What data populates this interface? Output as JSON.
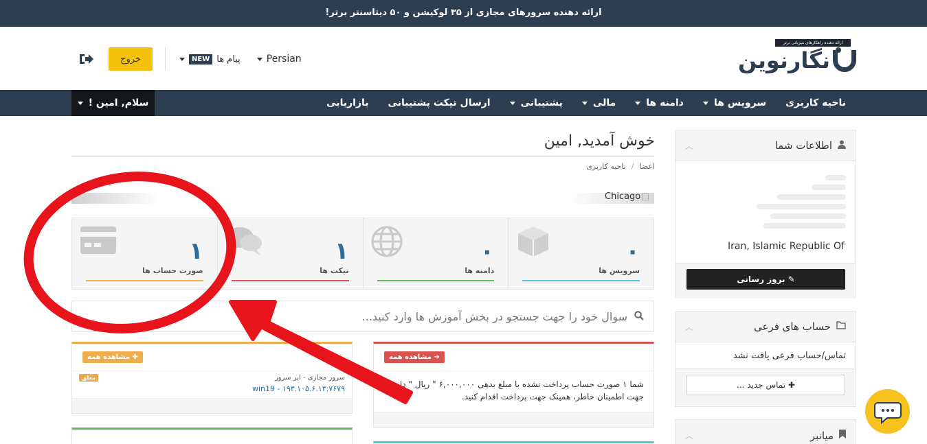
{
  "topbar": {
    "text": "ارائه دهنده سرورهای مجازی از ۳۵ لوکیشن و ۵۰ دیتاسنتر برتر!"
  },
  "logo": {
    "text": "نگارنوین",
    "tagline": "ارائه دهنده راهکارهای میزبانی برتر"
  },
  "header": {
    "language": "Persian",
    "messages_label": "پیام ها",
    "new_badge": "NEW",
    "logout_label": "خروج",
    "logout_icon": "sign-out-icon"
  },
  "nav": {
    "items": [
      {
        "label": "ناحیه کاربری",
        "dropdown": false
      },
      {
        "label": "سرویس ها",
        "dropdown": true
      },
      {
        "label": "دامنه ها",
        "dropdown": true
      },
      {
        "label": "مالی",
        "dropdown": true
      },
      {
        "label": "پشتیبانی",
        "dropdown": true
      },
      {
        "label": "ارسال تیکت پشتیبانی",
        "dropdown": false
      },
      {
        "label": "بازاریابی",
        "dropdown": false
      }
    ],
    "user_greeting": "سلام, امین !"
  },
  "sidebar": {
    "info_title": "اطلاعات شما",
    "info_country": "Iran, Islamic Republic Of",
    "update_button": "بروز رسانی",
    "subaccounts_title": "حساب های فرعی",
    "subaccounts_empty": "تماس/حساب فرعی یافت نشد",
    "new_contact_button": "تماس جدید ...",
    "shortcuts_title": "میانبر"
  },
  "main": {
    "welcome": "خوش آمدید, امین",
    "breadcrumb": [
      "اعضا",
      "ناحیه کاربری"
    ],
    "slider_label": "Chicago",
    "stats": [
      {
        "label": "سرویس ها",
        "value": "۰",
        "color": "#5bc0de",
        "icon": "box-icon"
      },
      {
        "label": "دامنه ها",
        "value": "۰",
        "color": "#5cb85c",
        "icon": "globe-icon"
      },
      {
        "label": "تیکت ها",
        "value": "۱",
        "color": "#d9534f",
        "icon": "comments-icon"
      },
      {
        "label": "صورت حساب ها",
        "value": "۱",
        "color": "#f0ad4e",
        "icon": "credit-card-icon"
      }
    ],
    "search_placeholder": "سوال خود را جهت جستجو در بخش آموزش ها وارد کنید...",
    "invoices_card": {
      "button": "مشاهده همه",
      "accent": "#d9534f",
      "text": "شما ۱ صورت حساب پرداخت نشده با مبلغ بدهی ۶,۰۰۰,۰۰۰ \" ریال \" دارید جهت اطمینان خاطر، همینک جهت پرداخت اقدام کنید."
    },
    "services_card": {
      "button": "مشاهده همه",
      "accent": "#f0ad4e",
      "service_name": "سرور مجازی - ابر سرور",
      "service_detail": "win19 - ۱۹۳.۱۰۵.۶.۱۳:۷۶۷۹",
      "status": "معلق"
    }
  }
}
